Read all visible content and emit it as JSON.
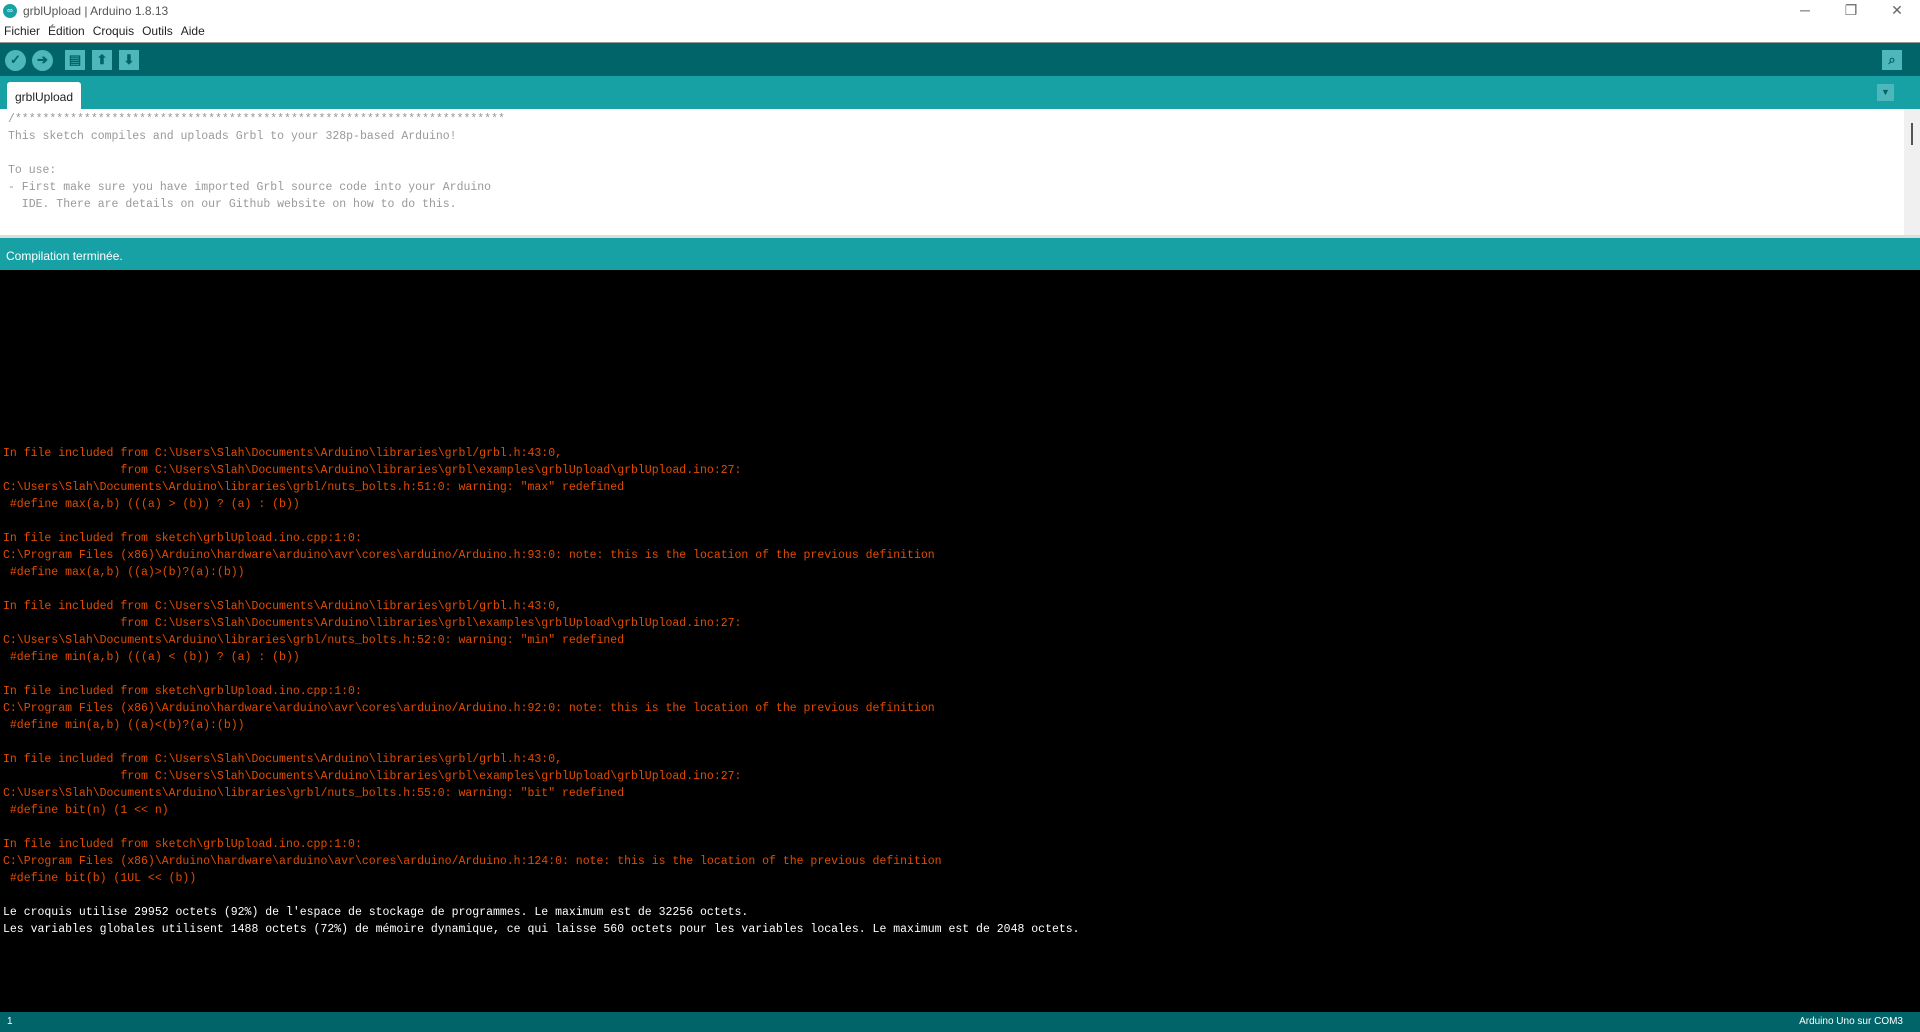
{
  "window": {
    "title": "grblUpload | Arduino 1.8.13",
    "minimize": "─",
    "maximize": "❐",
    "close": "✕"
  },
  "menu": [
    "Fichier",
    "Édition",
    "Croquis",
    "Outils",
    "Aide"
  ],
  "toolbar": {
    "verify": "✓",
    "upload": "➔",
    "new": "▤",
    "open": "⬆",
    "save": "⬇",
    "serial_monitor": "⌕"
  },
  "tab": {
    "label": "grblUpload",
    "menu_icon": "▼"
  },
  "editor": {
    "lines": [
      "/***********************************************************************",
      "This sketch compiles and uploads Grbl to your 328p-based Arduino!",
      "",
      "To use:",
      "- First make sure you have imported Grbl source code into your Arduino",
      "  IDE. There are details on our Github website on how to do this."
    ]
  },
  "status": "Compilation terminée.",
  "console": {
    "lines": [
      {
        "t": "In file included from C:\\Users\\Slah\\Documents\\Arduino\\libraries\\grbl/grbl.h:43:0,",
        "c": "err"
      },
      {
        "t": "                 from C:\\Users\\Slah\\Documents\\Arduino\\libraries\\grbl\\examples\\grblUpload\\grblUpload.ino:27:",
        "c": "err"
      },
      {
        "t": "C:\\Users\\Slah\\Documents\\Arduino\\libraries\\grbl/nuts_bolts.h:51:0: warning: \"max\" redefined",
        "c": "err"
      },
      {
        "t": " #define max(a,b) (((a) > (b)) ? (a) : (b))",
        "c": "err"
      },
      {
        "t": "",
        "c": "err"
      },
      {
        "t": "In file included from sketch\\grblUpload.ino.cpp:1:0:",
        "c": "err"
      },
      {
        "t": "C:\\Program Files (x86)\\Arduino\\hardware\\arduino\\avr\\cores\\arduino/Arduino.h:93:0: note: this is the location of the previous definition",
        "c": "err"
      },
      {
        "t": " #define max(a,b) ((a)>(b)?(a):(b))",
        "c": "err"
      },
      {
        "t": "",
        "c": "err"
      },
      {
        "t": "In file included from C:\\Users\\Slah\\Documents\\Arduino\\libraries\\grbl/grbl.h:43:0,",
        "c": "err"
      },
      {
        "t": "                 from C:\\Users\\Slah\\Documents\\Arduino\\libraries\\grbl\\examples\\grblUpload\\grblUpload.ino:27:",
        "c": "err"
      },
      {
        "t": "C:\\Users\\Slah\\Documents\\Arduino\\libraries\\grbl/nuts_bolts.h:52:0: warning: \"min\" redefined",
        "c": "err"
      },
      {
        "t": " #define min(a,b) (((a) < (b)) ? (a) : (b))",
        "c": "err"
      },
      {
        "t": "",
        "c": "err"
      },
      {
        "t": "In file included from sketch\\grblUpload.ino.cpp:1:0:",
        "c": "err"
      },
      {
        "t": "C:\\Program Files (x86)\\Arduino\\hardware\\arduino\\avr\\cores\\arduino/Arduino.h:92:0: note: this is the location of the previous definition",
        "c": "err"
      },
      {
        "t": " #define min(a,b) ((a)<(b)?(a):(b))",
        "c": "err"
      },
      {
        "t": "",
        "c": "err"
      },
      {
        "t": "In file included from C:\\Users\\Slah\\Documents\\Arduino\\libraries\\grbl/grbl.h:43:0,",
        "c": "err"
      },
      {
        "t": "                 from C:\\Users\\Slah\\Documents\\Arduino\\libraries\\grbl\\examples\\grblUpload\\grblUpload.ino:27:",
        "c": "err"
      },
      {
        "t": "C:\\Users\\Slah\\Documents\\Arduino\\libraries\\grbl/nuts_bolts.h:55:0: warning: \"bit\" redefined",
        "c": "err"
      },
      {
        "t": " #define bit(n) (1 << n)",
        "c": "err"
      },
      {
        "t": "",
        "c": "err"
      },
      {
        "t": "In file included from sketch\\grblUpload.ino.cpp:1:0:",
        "c": "err"
      },
      {
        "t": "C:\\Program Files (x86)\\Arduino\\hardware\\arduino\\avr\\cores\\arduino/Arduino.h:124:0: note: this is the location of the previous definition",
        "c": "err"
      },
      {
        "t": " #define bit(b) (1UL << (b))",
        "c": "err"
      },
      {
        "t": "",
        "c": "err"
      },
      {
        "t": "Le croquis utilise 29952 octets (92%) de l'espace de stockage de programmes. Le maximum est de 32256 octets.",
        "c": "info"
      },
      {
        "t": "Les variables globales utilisent 1488 octets (72%) de mémoire dynamique, ce qui laisse 560 octets pour les variables locales. Le maximum est de 2048 octets.",
        "c": "info"
      }
    ]
  },
  "bottom": {
    "line": "1",
    "board": "Arduino Uno sur COM3"
  }
}
